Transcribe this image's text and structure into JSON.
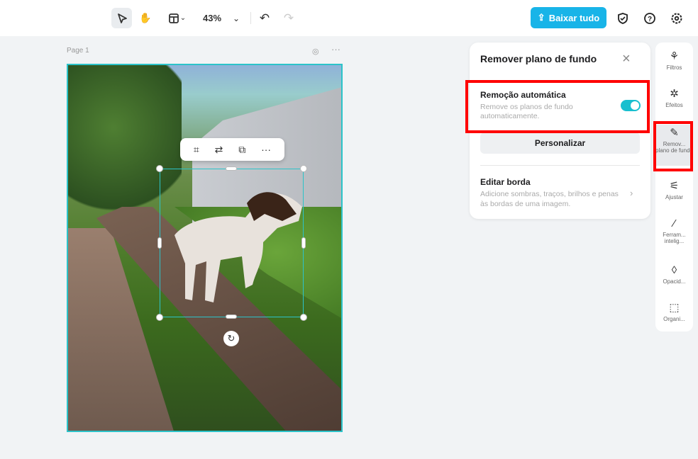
{
  "toolbar": {
    "zoom": "43%",
    "download_label": "Baixar tudo"
  },
  "canvas": {
    "page_label": "Page 1"
  },
  "panel": {
    "title": "Remover plano de fundo",
    "auto_title": "Remoção automática",
    "auto_desc": "Remove os planos de fundo automaticamente.",
    "auto_enabled": true,
    "customize_label": "Personalizar",
    "edge_title": "Editar borda",
    "edge_desc": "Adicione sombras, traços, brilhos e penas às bordas de uma imagem."
  },
  "sidebar": {
    "items": [
      {
        "label": "Filtros",
        "icon": "filters-icon"
      },
      {
        "label": "Efeitos",
        "icon": "effects-icon"
      },
      {
        "label": "Remov... plano de fundo",
        "icon": "remove-bg-icon"
      },
      {
        "label": "Ajustar",
        "icon": "adjust-icon"
      },
      {
        "label": "Ferram... intelig...",
        "icon": "smart-tools-icon"
      },
      {
        "label": "Opacid...",
        "icon": "opacity-icon"
      },
      {
        "label": "Organi...",
        "icon": "arrange-icon"
      }
    ]
  },
  "colors": {
    "accent": "#18b4e8",
    "toggle": "#19bfcf",
    "selection": "#2cc3c9",
    "highlight": "#ff0000"
  }
}
